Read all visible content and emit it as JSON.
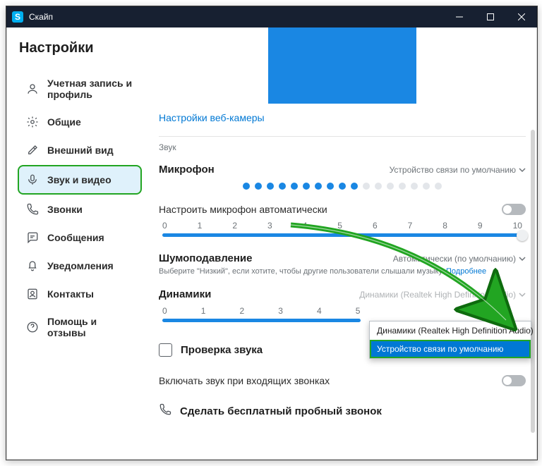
{
  "window": {
    "title": "Скайп"
  },
  "sidebar": {
    "title": "Настройки",
    "items": [
      {
        "label": "Учетная запись и профиль"
      },
      {
        "label": "Общие"
      },
      {
        "label": "Внешний вид"
      },
      {
        "label": "Звук и видео"
      },
      {
        "label": "Звонки"
      },
      {
        "label": "Сообщения"
      },
      {
        "label": "Уведомления"
      },
      {
        "label": "Контакты"
      },
      {
        "label": "Помощь и отзывы"
      }
    ]
  },
  "content": {
    "webcam_link": "Настройки веб-камеры",
    "sound_label": "Звук",
    "mic": {
      "title": "Микрофон",
      "device": "Устройство связи по умолчанию",
      "level_dots": 10,
      "total_dots": 17
    },
    "auto_adjust": "Настроить микрофон автоматически",
    "mic_slider": {
      "min": 0,
      "max": 10,
      "value": 10,
      "ticks": [
        "0",
        "1",
        "2",
        "3",
        "4",
        "5",
        "6",
        "7",
        "8",
        "9",
        "10"
      ]
    },
    "noise": {
      "title": "Шумоподавление",
      "value": "Автоматически (по умолчанию)",
      "hint_text": "Выберите \"Низкий\", если хотите, чтобы другие пользователи слышали музыку.",
      "hint_link": "Подробнее"
    },
    "speakers": {
      "title": "Динамики",
      "device": "Динамики (Realtek High Definition Audio)",
      "ticks": [
        "0",
        "1",
        "2",
        "3",
        "4",
        "5"
      ],
      "dropdown": {
        "opt1": "Динамики (Realtek High Definition Audio)",
        "opt2": "Устройство связи по умолчанию"
      }
    },
    "sound_test": "Проверка звука",
    "ring_on_call": "Включать звук при входящих звонках",
    "free_call": "Сделать бесплатный пробный звонок"
  }
}
